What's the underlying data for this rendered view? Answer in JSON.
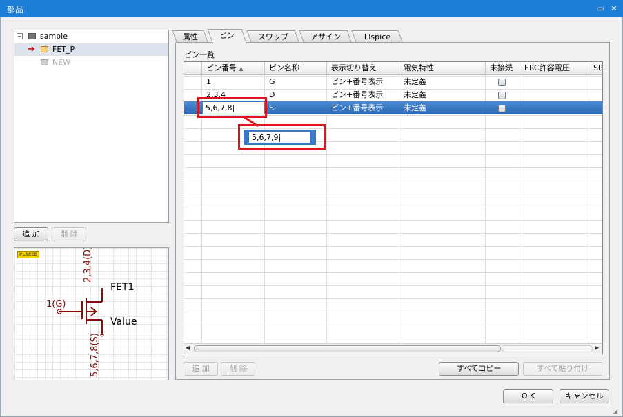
{
  "window": {
    "title": "部品"
  },
  "tree": {
    "root": "sample",
    "items": [
      {
        "label": "FET_P"
      },
      {
        "label": "NEW"
      }
    ]
  },
  "left_buttons": {
    "add": "追 加",
    "delete": "削 除"
  },
  "preview": {
    "badge": "PLACED",
    "pin_gate": "1(G)",
    "pin_drain": "2,3,4(D)",
    "pin_source": "5,6,7,8(S)",
    "ref": "FET1",
    "value": "Value"
  },
  "tabs": [
    "属性",
    "ピン",
    "スワップ",
    "アサイン",
    "LTspice"
  ],
  "pin_panel": {
    "title": "ピン一覧",
    "columns": [
      "ピン番号",
      "ピン名称",
      "表示切り替え",
      "電気特性",
      "未接続",
      "ERC許容電圧",
      "SP"
    ],
    "rows": [
      {
        "number": "1",
        "name": "G",
        "display": "ピン+番号表示",
        "electrical": "未定義"
      },
      {
        "number": "2,3,4",
        "name": "D",
        "display": "ピン+番号表示",
        "electrical": "未定義"
      },
      {
        "number": "5,6,7,8",
        "name": "S",
        "display": "ピン+番号表示",
        "electrical": "未定義"
      }
    ],
    "popup_value": "5,6,7,9"
  },
  "panel_buttons": {
    "add": "追 加",
    "delete": "削 除",
    "copy_all": "すべてコピー",
    "paste_all": "すべて貼り付け"
  },
  "dialog_buttons": {
    "ok": "O K",
    "cancel": "キャンセル"
  }
}
